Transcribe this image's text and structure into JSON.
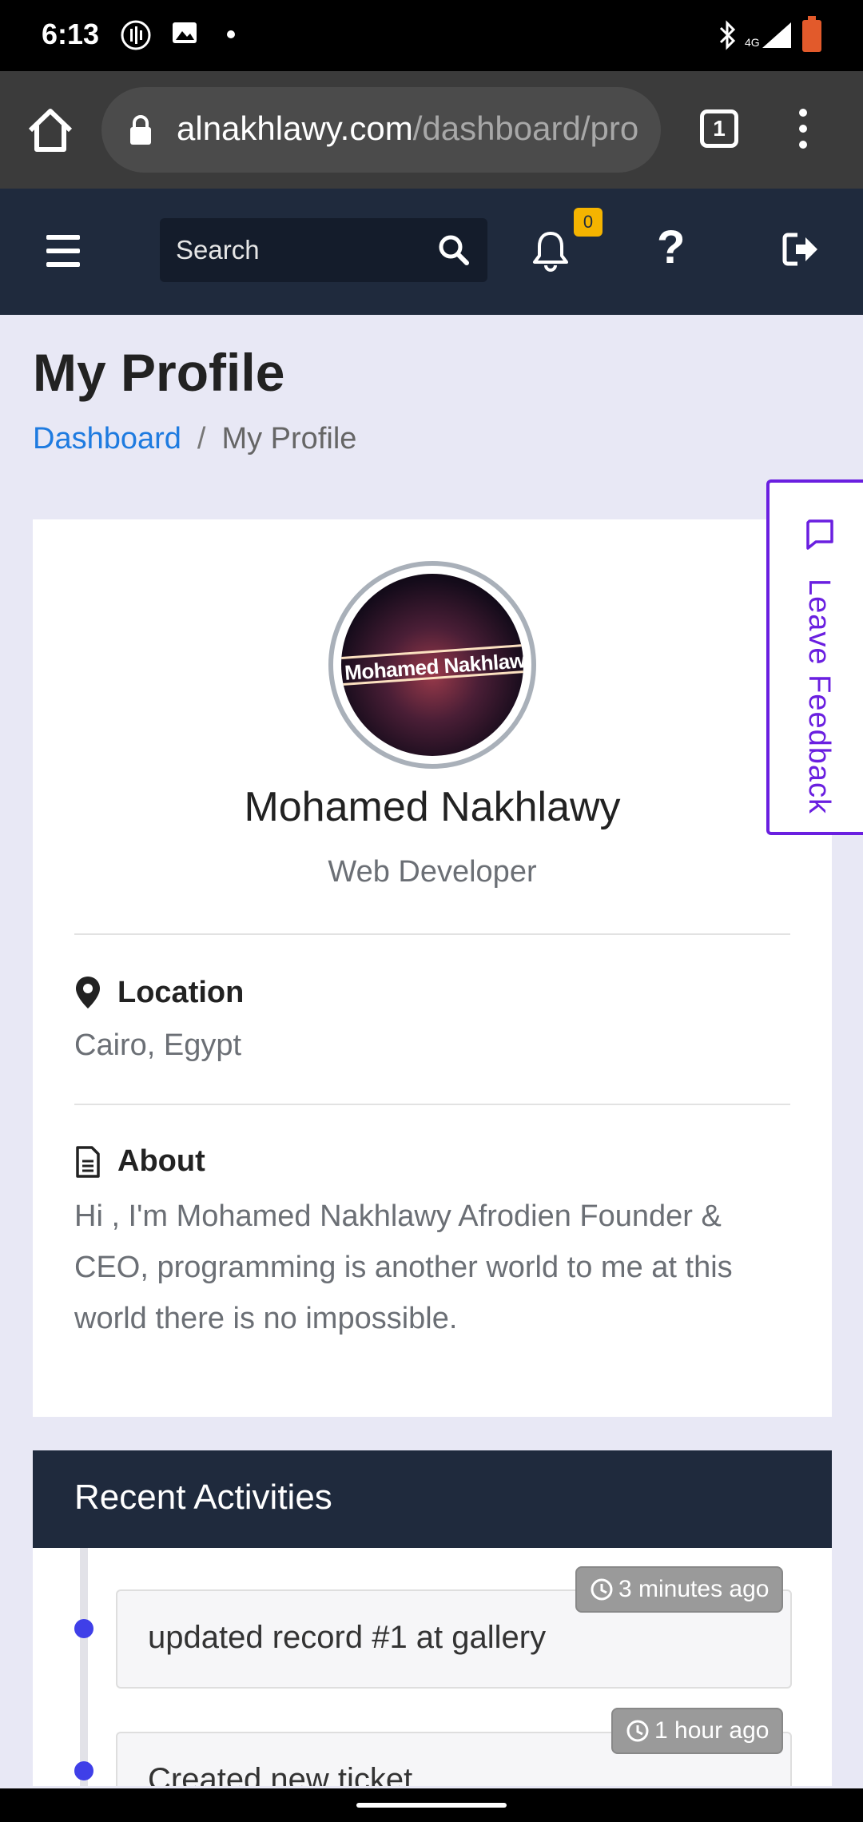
{
  "status_bar": {
    "time": "6:13",
    "battery_level": "15"
  },
  "browser": {
    "url_domain": "alnakhlawy.com",
    "url_path": "/dashboard/pro",
    "tab_count": "1"
  },
  "navbar": {
    "search_placeholder": "Search",
    "notification_count": "0",
    "help_label": "?"
  },
  "page": {
    "title": "My Profile",
    "breadcrumb": {
      "home": "Dashboard",
      "separator": "/",
      "current": "My Profile"
    }
  },
  "profile": {
    "avatar_text": "Mohamed Nakhlawy",
    "name": "Mohamed Nakhlawy",
    "role": "Web Developer",
    "location_label": "Location",
    "location_value": "Cairo, Egypt",
    "about_label": "About",
    "about_text": "Hi , I'm Mohamed Nakhlawy Afrodien Founder & CEO, programming is another world to me at this world there is no impossible."
  },
  "feedback": {
    "label": "Leave Feedback"
  },
  "activities": {
    "title": "Recent Activities",
    "items": [
      {
        "text": "updated record #1 at gallery",
        "time": "3 minutes ago"
      },
      {
        "text": "Created new ticket",
        "time": "1 hour ago"
      }
    ]
  },
  "colors": {
    "navbar_bg": "#1f2a3d",
    "page_bg": "#e8e8f5",
    "link": "#1e7be0",
    "feedback_accent": "#6a1fe0",
    "badge": "#f5b400",
    "timeline_dot": "#3f3fe8"
  }
}
